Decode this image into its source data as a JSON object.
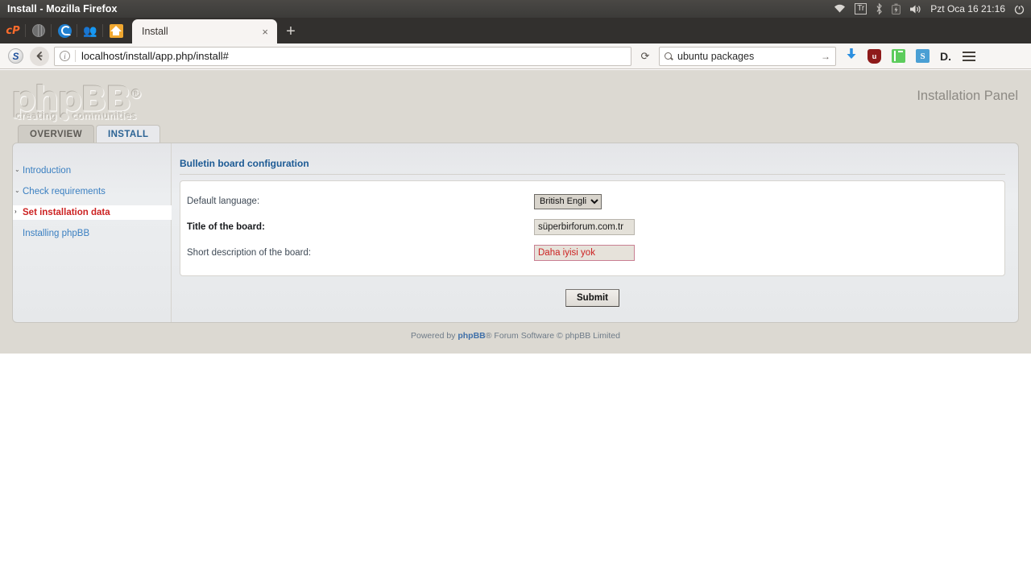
{
  "window": {
    "title": "Install - Mozilla Firefox"
  },
  "systray": {
    "wifi_icon": "wifi-icon",
    "keyboard_layout": "Tr",
    "bluetooth_icon": "bluetooth-icon",
    "battery_icon": "battery-icon",
    "volume_icon": "volume-icon",
    "clock": "Pzt Oca 16 21:16",
    "power_icon": "power-icon"
  },
  "browser": {
    "pinned_tabs": [
      {
        "name": "cpanel-icon",
        "label": "cP"
      },
      {
        "name": "globe-icon",
        "label": ""
      },
      {
        "name": "swirl-icon",
        "label": ""
      },
      {
        "name": "people-icon",
        "label": "\u0001"
      },
      {
        "name": "home-icon",
        "label": ""
      }
    ],
    "active_tab": "Install",
    "tab_close_icon": "×",
    "new_tab_icon": "+",
    "s_icon": "S",
    "back_icon": "←",
    "info_icon": "i",
    "url_host": "localhost",
    "url_path": "/install/app.php/install#",
    "reload_icon": "⟳",
    "search_value": "ubuntu packages",
    "search_go_icon": "→",
    "toolbar_icons": [
      "download-arrow-icon",
      "ublock-origin-icon",
      "green-extension-icon",
      "blue-s-extension-icon",
      "d-extension-icon"
    ],
    "menu_icon": "hamburger-menu-icon"
  },
  "phpbb": {
    "logo_text": "phpBB",
    "logo_reg": "®",
    "logo_tagline": "creating ● communities",
    "panel_title": "Installation Panel",
    "tabs": [
      {
        "label": "OVERVIEW",
        "active": false
      },
      {
        "label": "INSTALL",
        "active": true
      }
    ],
    "sidebar": [
      {
        "label": "Introduction",
        "state": "done",
        "chevron": "⌄"
      },
      {
        "label": "Check requirements",
        "state": "done",
        "chevron": "⌄"
      },
      {
        "label": "Set installation data",
        "state": "active",
        "chevron": "›"
      },
      {
        "label": "Installing phpBB",
        "state": "pending",
        "chevron": ""
      }
    ],
    "content_title": "Bulletin board configuration",
    "fields": [
      {
        "label": "Default language:",
        "bold": false,
        "type": "select",
        "value": "British English",
        "options": [
          "British English"
        ]
      },
      {
        "label": "Title of the board:",
        "bold": true,
        "type": "text",
        "value": "süperbirforum.com.tr",
        "placeholder": "",
        "focused": false
      },
      {
        "label": "Short description of the board:",
        "bold": false,
        "type": "text",
        "value": "Daha iyisi yok",
        "placeholder": "",
        "focused": true
      }
    ],
    "submit_label": "Submit",
    "footer_pre": "Powered by ",
    "footer_brand": "phpBB",
    "footer_post": "® Forum Software © phpBB Limited"
  },
  "colors": {
    "accent_blue": "#3a7fc1",
    "active_red": "#cc2222",
    "panel_bg": "#dcd9d2",
    "title_blue": "#1c5a94"
  }
}
